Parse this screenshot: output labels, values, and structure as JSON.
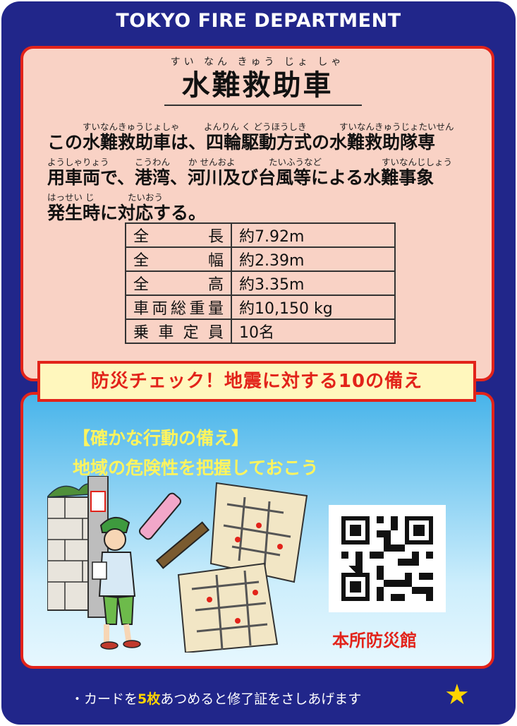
{
  "header": "TOKYO FIRE DEPARTMENT",
  "title": {
    "ruby": "すい なん きゅう じょ しゃ",
    "text": "水難救助車"
  },
  "description": {
    "lines": [
      {
        "ruby": [
          "すいなんきゅうじょしゃ",
          "よんりん く どうほうしき",
          "すいなんきゅうじょたいせん"
        ],
        "text": "この水難救助車は、四輪駆動方式の水難救助隊専"
      },
      {
        "ruby": [
          "ようしゃりょう",
          "こうわん",
          "か せんおよ",
          "たいふうなど",
          "すいなんじしょう"
        ],
        "text": "用車両で、港湾、河川及び台風等による水難事象"
      },
      {
        "ruby": [
          "はっせい じ",
          "たいおう"
        ],
        "text": "発生時に対応する。"
      }
    ]
  },
  "specs": [
    {
      "label": "全 長",
      "value": "約7.92m"
    },
    {
      "label": "全 幅",
      "value": "約2.39m"
    },
    {
      "label": "全 高",
      "value": "約3.35m"
    },
    {
      "label": "車両総重量",
      "value": "約10,150 kg"
    },
    {
      "label": "乗車定員",
      "value": "10名"
    }
  ],
  "banner": "防災チェック！地震に対する10の備え",
  "section": {
    "subtitle": "【確かな行動の備え】",
    "message": "地域の危険性を把握しておこう"
  },
  "qr_label": "本所防災館",
  "footer": {
    "before": "・カードを",
    "highlight": "5枚",
    "after": "あつめると修了証をさしあげます"
  },
  "star": "★",
  "colors": {
    "card_blue": "#21268a",
    "frame_red": "#e2231a",
    "panel_pink": "#f9d2c5",
    "accent_yellow": "#fff45e"
  }
}
